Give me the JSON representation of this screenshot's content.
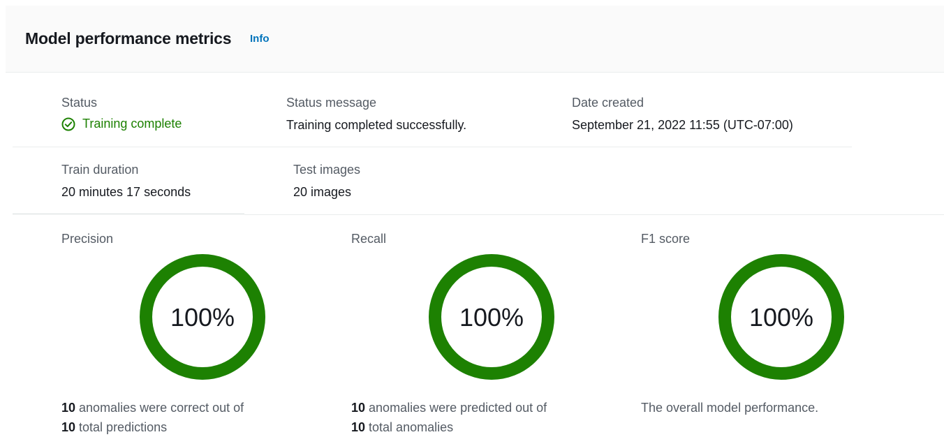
{
  "header": {
    "title": "Model performance metrics",
    "info_label": "Info"
  },
  "details": {
    "status": {
      "label": "Status",
      "value": "Training complete",
      "icon": "check-circle-icon",
      "color": "#1d8102"
    },
    "status_message": {
      "label": "Status message",
      "value": "Training completed successfully."
    },
    "date_created": {
      "label": "Date created",
      "value": "September 21, 2022 11:55 (UTC-07:00)"
    },
    "train_duration": {
      "label": "Train duration",
      "value": "20 minutes 17 seconds"
    },
    "test_images": {
      "label": "Test images",
      "value": "20 images"
    }
  },
  "metrics": [
    {
      "label": "Precision",
      "value_text": "100%",
      "fraction": 1.0,
      "line1_num": "10",
      "line1_text": " anomalies were correct out of",
      "line2_num": "10",
      "line2_text": " total predictions"
    },
    {
      "label": "Recall",
      "value_text": "100%",
      "fraction": 1.0,
      "line1_num": "10",
      "line1_text": " anomalies were predicted out of",
      "line2_num": "10",
      "line2_text": " total anomalies"
    },
    {
      "label": "F1 score",
      "value_text": "100%",
      "fraction": 1.0,
      "desc": "The overall model performance."
    }
  ],
  "colors": {
    "ring": "#1d8102",
    "ring_track": "#eaeded",
    "link": "#0073bb"
  }
}
